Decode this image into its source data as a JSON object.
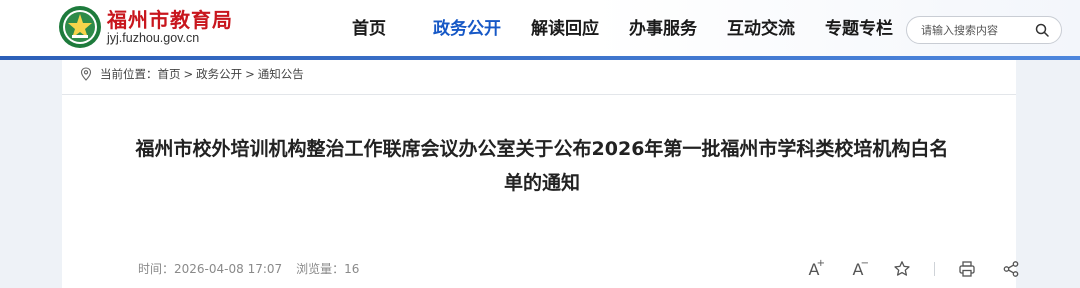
{
  "header": {
    "site_name": "福州市教育局",
    "site_domain": "jyj.fuzhou.gov.cn",
    "logo_icon": "emblem-icon"
  },
  "nav": {
    "items": [
      {
        "label": "首页",
        "active": false
      },
      {
        "label": "政务公开",
        "active": true
      },
      {
        "label": "解读回应",
        "active": false
      },
      {
        "label": "办事服务",
        "active": false
      },
      {
        "label": "互动交流",
        "active": false
      },
      {
        "label": "专题专栏",
        "active": false
      }
    ]
  },
  "search": {
    "placeholder": "请输入搜索内容",
    "icon": "search-icon"
  },
  "breadcrumb": {
    "prefix": "当前位置：",
    "items": [
      "首页",
      "政务公开",
      "通知公告"
    ],
    "separator": ">"
  },
  "article": {
    "title": "福州市校外培训机构整治工作联席会议办公室关于公布2026年第一批福州市学科类校培机构白名单的通知",
    "time_label": "时间：",
    "time_value": "2026-04-08 17:07",
    "views_label": "浏览量：",
    "views_value": "16"
  },
  "tools": {
    "font_letter": "A",
    "font_increase_sign": "+",
    "font_decrease_sign": "−",
    "icons": [
      "font-increase-icon",
      "font-decrease-icon",
      "star-icon",
      "print-icon",
      "share-icon"
    ]
  },
  "colors": {
    "brand_red": "#c8161d",
    "nav_active": "#1658c6",
    "bar_blue": "#2c5fb8",
    "logo_green": "#1e7b3c"
  }
}
